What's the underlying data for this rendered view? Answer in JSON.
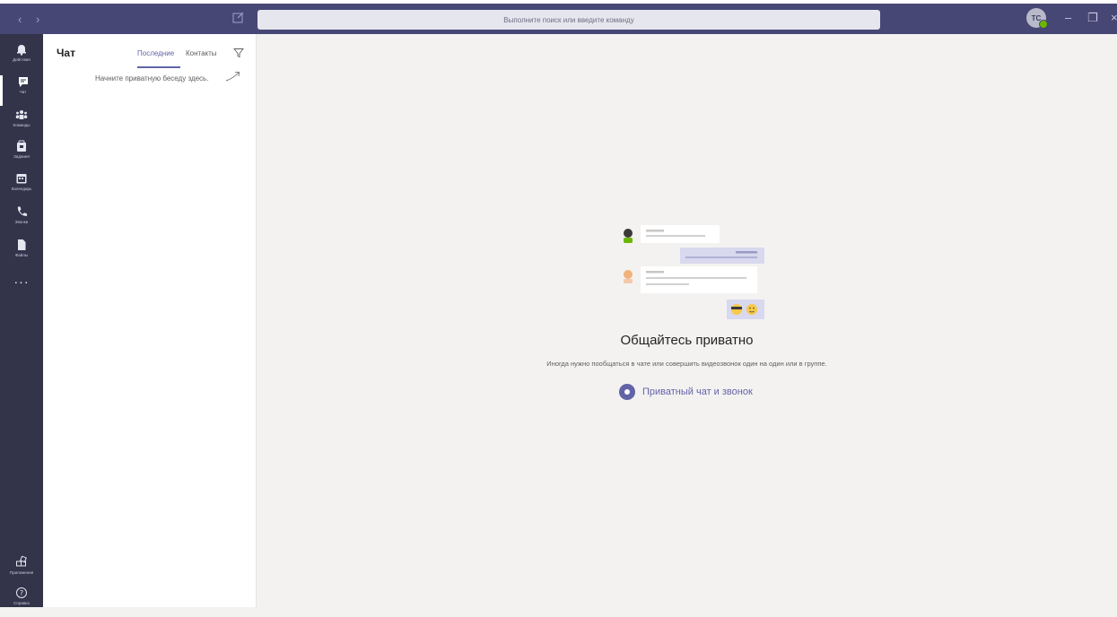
{
  "search": {
    "placeholder": "Выполните поиск или введите команду"
  },
  "user": {
    "initials": "TC",
    "status_color": "#6bb700"
  },
  "rail": {
    "items": [
      {
        "label": "Действия",
        "icon": "bell-icon"
      },
      {
        "label": "Чат",
        "icon": "chat-icon"
      },
      {
        "label": "Команды",
        "icon": "teams-icon"
      },
      {
        "label": "Задания",
        "icon": "assignments-icon"
      },
      {
        "label": "Календарь",
        "icon": "calendar-icon"
      },
      {
        "label": "Звонки",
        "icon": "phone-icon"
      },
      {
        "label": "Файлы",
        "icon": "file-icon"
      }
    ],
    "more": "···",
    "apps_label": "Приложения",
    "help_label": "Справка"
  },
  "chat_panel": {
    "title": "Чат",
    "tabs": [
      "Последние",
      "Контакты"
    ],
    "active_tab": "Последние",
    "hint": "Начните приватную беседу здесь."
  },
  "main": {
    "headline": "Общайтесь приватно",
    "subline": "Иногда нужно пообщаться в чате или совершить видеозвонок один на один или в группе.",
    "cta": "Приватный чат и звонок"
  },
  "colors": {
    "accent": "#6264a7",
    "titlebar": "#464775",
    "rail": "#33344a"
  }
}
